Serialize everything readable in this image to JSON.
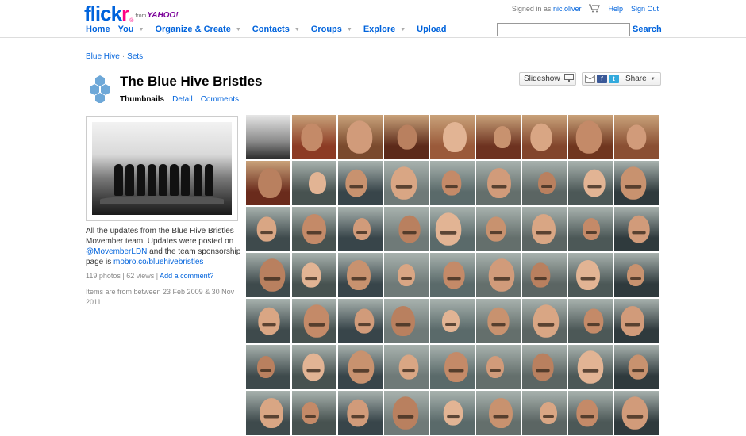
{
  "logo": {
    "brand": "flickr",
    "from": "from",
    "partner": "YAHOO!"
  },
  "account": {
    "signed_in_prefix": "Signed in as",
    "username": "nic.oliver",
    "help": "Help",
    "sign_out": "Sign Out"
  },
  "nav": {
    "home": "Home",
    "you": "You",
    "organize": "Organize & Create",
    "contacts": "Contacts",
    "groups": "Groups",
    "explore": "Explore",
    "upload": "Upload"
  },
  "search": {
    "button": "Search",
    "value": ""
  },
  "breadcrumb": {
    "owner": "Blue Hive",
    "sets": "Sets"
  },
  "set": {
    "title": "The Blue Hive Bristles",
    "tabs": {
      "thumbnails": "Thumbnails",
      "detail": "Detail",
      "comments": "Comments"
    },
    "slideshow": "Slideshow",
    "share": "Share",
    "desc_1": "All the updates from the Blue Hive Bristles Movember team. Updates were posted on ",
    "desc_link1": "@MovemberLDN",
    "desc_2": " and the team sponsorship page is ",
    "desc_link2": "mobro.co/bluehivebristles",
    "stats_text": "119 photos | 62 views |",
    "add_comment": "Add a comment?",
    "range": "Items are from between 23 Feb 2009 & 30 Nov 2011."
  },
  "icons": {
    "cart": "cart-icon",
    "slideshow": "monitor-icon",
    "mail": "mail-icon",
    "facebook": "facebook-icon",
    "twitter": "twitter-icon",
    "set": "hexagon-set-icon"
  },
  "colors": {
    "link_blue": "#0063dc",
    "flickr_pink": "#ff0084",
    "yahoo_purple": "#7b0099"
  }
}
